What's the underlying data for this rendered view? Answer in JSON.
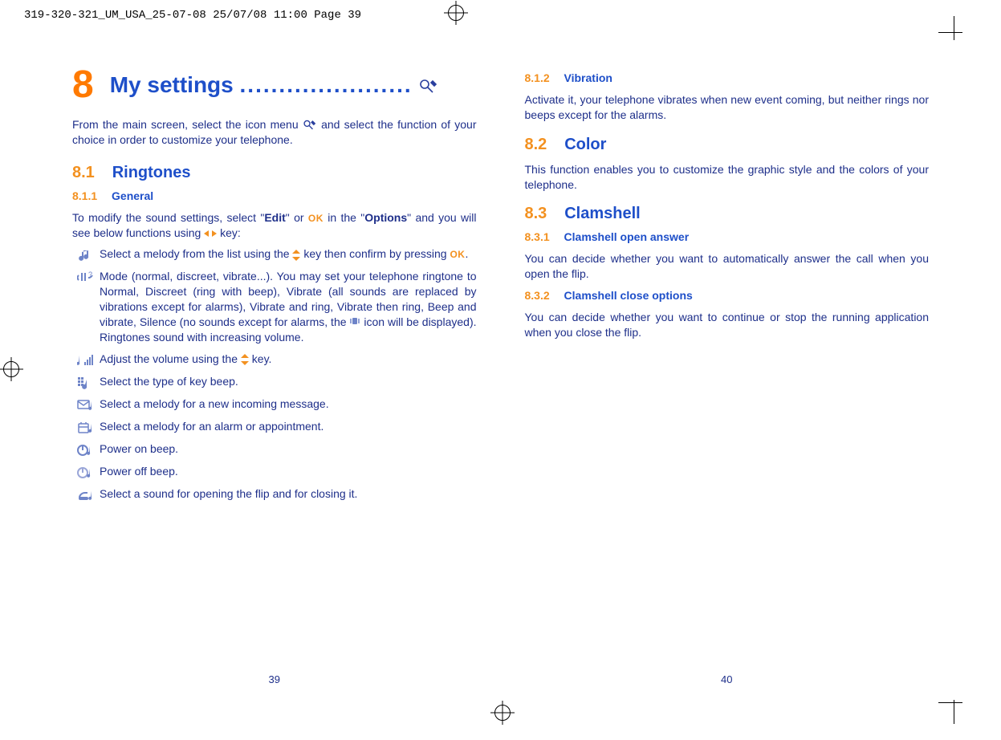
{
  "print_header": "319-320-321_UM_USA_25-07-08  25/07/08  11:00  Page 39",
  "chapter": {
    "num": "8",
    "title": "My settings",
    "dots": "......................"
  },
  "intro_before": "From the main screen, select the icon menu ",
  "intro_after": " and select the function of your choice in order to customize your telephone.",
  "s81": {
    "num": "8.1",
    "title": "Ringtones"
  },
  "s811": {
    "num": "8.1.1",
    "title": "General"
  },
  "general_intro_1": "To modify the sound settings, select \"",
  "general_intro_edit": "Edit",
  "general_intro_2": "\" or ",
  "general_intro_3": " in the \"",
  "general_intro_options": "Options",
  "general_intro_4": "\" and you will see below functions using ",
  "general_intro_5": " key:",
  "rows": [
    {
      "text_before": "Select a melody from the list using the ",
      "text_after": " key then confirm by pressing ",
      "text_tail": ".",
      "has_updown": true,
      "has_ok": true
    },
    {
      "text": "Mode (normal, discreet, vibrate...). You may set your telephone ringtone to Normal, Discreet (ring with beep), Vibrate (all sounds are replaced by vibrations except for alarms), Vibrate and ring, Vibrate then ring, Beep and vibrate, Silence (no sounds except for alarms, the ",
      " text_mid_after": " icon will be displayed). Ringtones sound with increasing volume."
    },
    {
      "text_before": "Adjust the volume using the ",
      "text_after": " key.",
      "has_updown": true
    },
    {
      "text": "Select the type of key beep."
    },
    {
      "text": "Select a melody for a new incoming message."
    },
    {
      "text": "Select a melody for an alarm or appointment."
    },
    {
      "text": "Power on beep."
    },
    {
      "text": "Power off beep."
    },
    {
      "text": "Select a sound for opening the flip and for closing it."
    }
  ],
  "ok_label": "OK",
  "s812": {
    "num": "8.1.2",
    "title": "Vibration"
  },
  "vibration_body": "Activate it, your telephone vibrates when new event coming, but neither rings nor beeps except for the alarms.",
  "s82": {
    "num": "8.2",
    "title": "Color"
  },
  "color_body": "This function enables you to customize the graphic style and the colors of your telephone.",
  "s83": {
    "num": "8.3",
    "title": "Clamshell"
  },
  "s831": {
    "num": "8.3.1",
    "title": "Clamshell open answer"
  },
  "s831_body": "You can decide whether you want to automatically answer the call when you open the flip.",
  "s832": {
    "num": "8.3.2",
    "title": "Clamshell close options"
  },
  "s832_body": "You can decide whether you want to continue or stop the running application when you close the flip.",
  "page_left": "39",
  "page_right": "40",
  "icons": {
    "melody": "music-note-icon",
    "mode": "mode-ring-icon",
    "volume": "volume-bars-icon",
    "keybeep": "keypad-beep-icon",
    "message": "message-melody-icon",
    "alarm": "alarm-melody-icon",
    "poweron": "power-on-icon",
    "poweroff": "power-off-icon",
    "flip": "flip-sound-icon",
    "vibrate": "vibrate-icon",
    "tools": "settings-tools-icon"
  }
}
